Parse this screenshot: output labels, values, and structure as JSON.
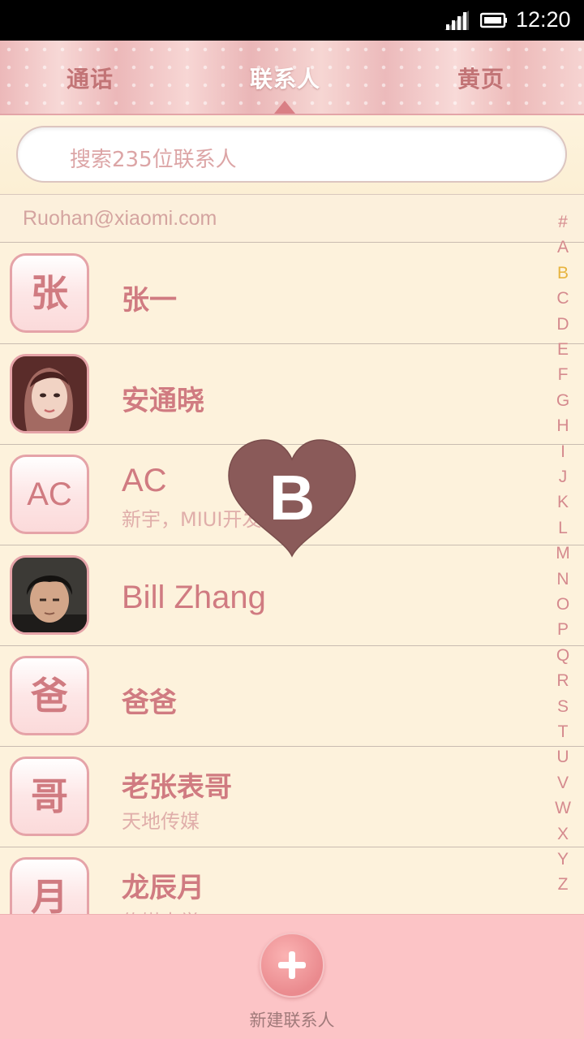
{
  "status_bar": {
    "time": "12:20",
    "icons": [
      "signal-icon",
      "battery-icon"
    ]
  },
  "tabs": [
    {
      "label": "通话",
      "active": false
    },
    {
      "label": "联系人",
      "active": true
    },
    {
      "label": "黄页",
      "active": false
    }
  ],
  "search": {
    "placeholder": "搜索235位联系人"
  },
  "account": {
    "email": "Ruohan@xiaomi.com"
  },
  "contacts": [
    {
      "avatar_text": "张",
      "avatar_type": "text",
      "name": "张一",
      "subtitle": ""
    },
    {
      "avatar_text": "",
      "avatar_type": "photo",
      "name": "安通晓",
      "subtitle": ""
    },
    {
      "avatar_text": "AC",
      "avatar_type": "text",
      "name": "AC",
      "subtitle": "新宇，MIUI开发"
    },
    {
      "avatar_text": "",
      "avatar_type": "photo",
      "name": "Bill Zhang",
      "subtitle": ""
    },
    {
      "avatar_text": "爸",
      "avatar_type": "text",
      "name": "爸爸",
      "subtitle": ""
    },
    {
      "avatar_text": "哥",
      "avatar_type": "text",
      "name": "老张表哥",
      "subtitle": "天地传媒"
    },
    {
      "avatar_text": "月",
      "avatar_type": "text",
      "name": "龙辰月",
      "subtitle": "传媒大学"
    }
  ],
  "index_letters": [
    "#",
    "A",
    "B",
    "C",
    "D",
    "E",
    "F",
    "G",
    "H",
    "I",
    "J",
    "K",
    "L",
    "M",
    "N",
    "O",
    "P",
    "Q",
    "R",
    "S",
    "T",
    "U",
    "V",
    "W",
    "X",
    "Y",
    "Z"
  ],
  "index_selected": "B",
  "overlay": {
    "letter": "B",
    "shape": "heart-icon"
  },
  "bottom": {
    "add_label": "新建联系人",
    "add_icon": "plus-icon"
  },
  "colors": {
    "accent": "#d07b81",
    "background": "#fdf2dc",
    "bottom_bar": "#fcc4c6",
    "heart": "#8a5a59",
    "index_selected": "#e7b43e"
  }
}
